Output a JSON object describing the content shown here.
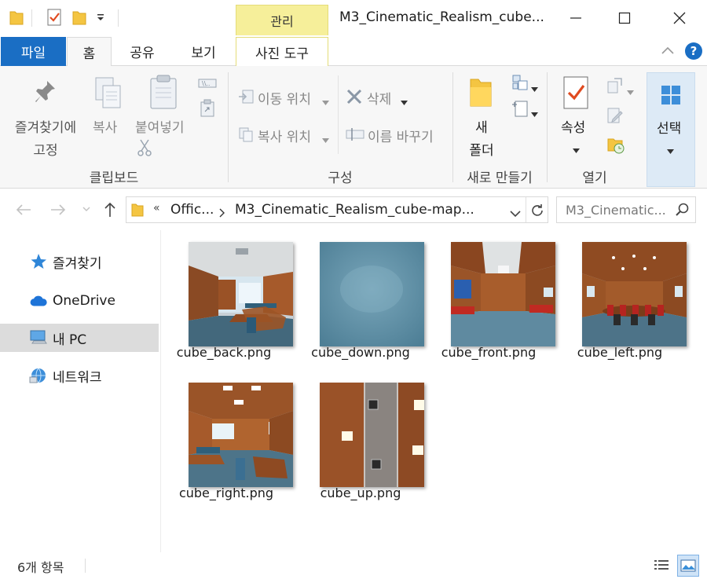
{
  "window": {
    "title": "M3_Cinematic_Realism_cube...",
    "context_tab": "관리"
  },
  "tabs": [
    {
      "label": "파일"
    },
    {
      "label": "홈"
    },
    {
      "label": "공유"
    },
    {
      "label": "보기"
    },
    {
      "label": "사진 도구"
    }
  ],
  "ribbon": {
    "clipboard": {
      "pin_line1": "즐겨찾기에",
      "pin_line2": "고정",
      "copy": "복사",
      "paste": "붙여넣기",
      "group": "클립보드"
    },
    "organize": {
      "move_to": "이동 위치",
      "copy_to": "복사 위치",
      "delete": "삭제",
      "rename": "이름 바꾸기",
      "group": "구성"
    },
    "new": {
      "folder_line1": "새",
      "folder_line2": "폴더",
      "group": "새로 만들기"
    },
    "open": {
      "properties": "속성",
      "group": "열기"
    },
    "select": {
      "label": "선택"
    }
  },
  "address": {
    "crumb1": "Offic...",
    "crumb2": "M3_Cinematic_Realism_cube-map...",
    "search_placeholder": "M3_Cinematic..."
  },
  "nav": [
    {
      "label": "즐겨찾기"
    },
    {
      "label": "OneDrive"
    },
    {
      "label": "내 PC"
    },
    {
      "label": "네트워크"
    }
  ],
  "files": [
    {
      "name": "cube_back.png"
    },
    {
      "name": "cube_down.png"
    },
    {
      "name": "cube_front.png"
    },
    {
      "name": "cube_left.png"
    },
    {
      "name": "cube_right.png"
    },
    {
      "name": "cube_up.png"
    }
  ],
  "status": {
    "count": "6개 항목"
  },
  "colors": {
    "accent": "#1a6ec4",
    "context_tab": "#f6ef9a",
    "selected_nav": "#dcdcdc"
  }
}
